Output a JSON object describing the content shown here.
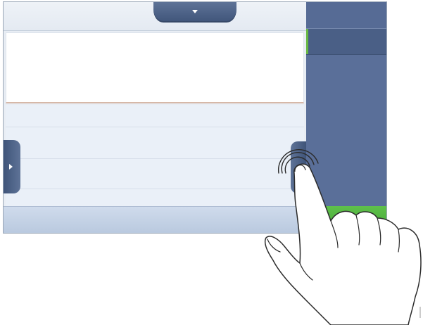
{
  "device": {
    "colors": {
      "panel_blue": "#5a6f99",
      "tab_blue": "#4a5f86",
      "accent_green": "#5ec04a",
      "screen_bg": "#e8edf4"
    }
  },
  "header": {
    "pull_down_tab_icon": "caret-down-icon"
  },
  "side_panel": {
    "items": [
      {
        "state": "default"
      },
      {
        "state": "selected"
      }
    ],
    "confirm_button_color": "#5ec04a"
  },
  "handles": {
    "left_icon": "caret-right-icon",
    "right_icon": "none"
  },
  "gesture": {
    "type": "tap",
    "icon": "hand-pointer-icon",
    "target": "right-edge-handle"
  }
}
